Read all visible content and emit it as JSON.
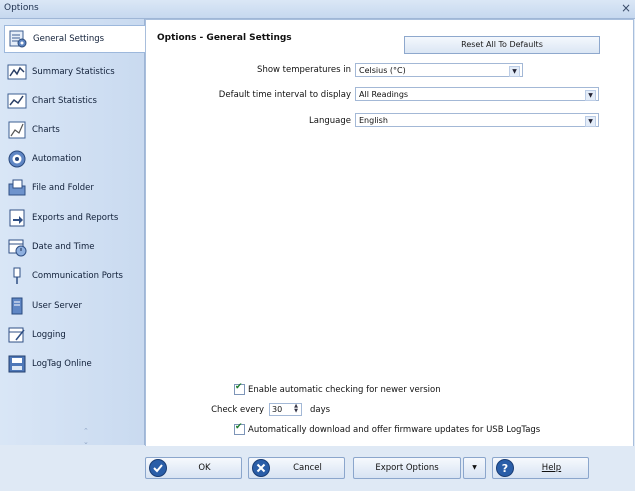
{
  "window": {
    "title": "Options",
    "close_glyph": "×"
  },
  "sidebar": {
    "items": [
      {
        "label": "General Settings",
        "icon": "general-settings-icon"
      },
      {
        "label": "Summary Statistics",
        "icon": "summary-statistics-icon"
      },
      {
        "label": "Chart Statistics",
        "icon": "chart-statistics-icon"
      },
      {
        "label": "Charts",
        "icon": "charts-icon"
      },
      {
        "label": "Automation",
        "icon": "automation-icon"
      },
      {
        "label": "File and Folder",
        "icon": "folder-icon"
      },
      {
        "label": "Exports and Reports",
        "icon": "export-icon"
      },
      {
        "label": "Date and Time",
        "icon": "calendar-icon"
      },
      {
        "label": "Communication Ports",
        "icon": "port-icon"
      },
      {
        "label": "User Server",
        "icon": "server-icon"
      },
      {
        "label": "Logging",
        "icon": "logging-icon"
      },
      {
        "label": "LogTag Online",
        "icon": "logtag-online-icon"
      }
    ],
    "selected": "General Settings"
  },
  "main": {
    "title": "Options - General Settings",
    "reset_button": "Reset All To Defaults",
    "temperature": {
      "label": "Show temperatures in",
      "value": "Celsius (°C)"
    },
    "interval": {
      "label": "Default time interval to display",
      "value": "All Readings"
    },
    "language": {
      "label": "Language",
      "value": "English"
    },
    "auto_check": {
      "label": "Enable automatic checking for newer version",
      "checked": true
    },
    "check_every": {
      "prefix": "Check every",
      "value": "30",
      "suffix": "days"
    },
    "auto_download": {
      "label": "Automatically download and offer firmware updates for USB LogTags",
      "checked": true
    }
  },
  "buttons": {
    "ok": "OK",
    "cancel": "Cancel",
    "export_options": "Export Options",
    "help": "Help"
  },
  "colors": {
    "accent": "#2a5ea8",
    "window_bg": "#dfe9f5",
    "selected_bg": "#ffffff"
  }
}
